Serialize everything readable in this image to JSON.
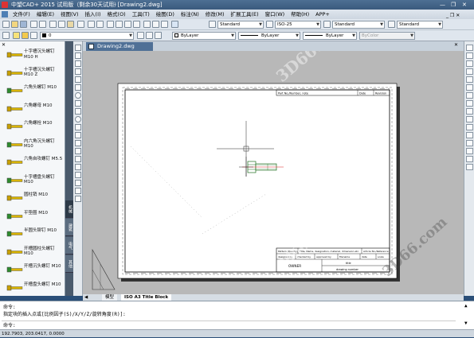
{
  "window": {
    "app_name": "中望CAD+ 2015 试用版（剩余30天试用）",
    "doc_title": "- [Drawing2.dwg]",
    "controls": [
      "—",
      "❐",
      "✕"
    ]
  },
  "menu": [
    "文件(F)",
    "编辑(E)",
    "视图(V)",
    "插入(I)",
    "格式(O)",
    "工具(T)",
    "绘图(D)",
    "标注(N)",
    "修改(M)",
    "扩展工具(E)",
    "窗口(W)",
    "帮助(H)",
    "APP+"
  ],
  "toolbar": {
    "text_style": "Standard",
    "dim_style": "ISO-25",
    "table_style": "Standard",
    "multileader_style": "Standard",
    "layer": "0",
    "color": "ByLayer",
    "linetype": "ByLayer",
    "lineweight": "ByLayer",
    "plotstyle": "ByColor"
  },
  "palette": {
    "items": [
      {
        "label": "十字槽沉头螺钉 M10 H",
        "icon": "countersunk-cross-screw-icon"
      },
      {
        "label": "十字槽沉头螺钉 M10 Z",
        "icon": "countersunk-cross-screw-icon"
      },
      {
        "label": "六角头螺钉 M10",
        "icon": "hex-bolt-icon"
      },
      {
        "label": "六角螺母 M10",
        "icon": "hex-nut-icon"
      },
      {
        "label": "六角螺栓 M10",
        "icon": "hex-bolt-icon"
      },
      {
        "label": "内六角沉头螺钉 M10",
        "icon": "socket-countersunk-screw-icon"
      },
      {
        "label": "六角自攻螺钉 M5.5",
        "icon": "tapping-screw-icon"
      },
      {
        "label": "十字槽盘头螺钉 M10",
        "icon": "pan-head-screw-icon"
      },
      {
        "label": "圆柱销 M10",
        "icon": "cylinder-pin-icon"
      },
      {
        "label": "平垫圈 M10",
        "icon": "washer-icon"
      },
      {
        "label": "半圆头铆钉 M10",
        "icon": "rivet-icon"
      },
      {
        "label": "开槽圆柱头螺钉 M10",
        "icon": "slotted-cheese-screw-icon"
      },
      {
        "label": "开槽沉头螺钉 M10",
        "icon": "slotted-countersunk-screw-icon"
      },
      {
        "label": "开槽盘头螺钉 M10",
        "icon": "slotted-pan-screw-icon"
      }
    ],
    "vertical_tabs": [
      "机械",
      "建筑",
      "电气",
      "其他"
    ]
  },
  "document_tab": "Drawing2.dwg",
  "title_block": {
    "header_cells": [
      "Part No./Number, note",
      "Date",
      "Revision"
    ],
    "mid_row": [
      "Pattern (Quality)",
      "Title, Name, designation, material, dimension etc.",
      "Article No./Reference"
    ],
    "sign_row": [
      "designed by",
      "checked by",
      "approved by",
      "filename",
      "date",
      "scale"
    ],
    "owner": "OWNER",
    "title": "title",
    "drawing_number": "drawing number"
  },
  "layout_tabs": [
    "模型",
    "ISO A3 Title Block"
  ],
  "command": {
    "line1": "命令:",
    "line2": "指定块的插入点或[比例因子(S)/X/Y/Z/旋转角度(R)]:",
    "prompt": "命令:"
  },
  "status": {
    "coordinates": "192.7903, 203.0417, 0.0000"
  },
  "watermarks": [
    "3d66.com",
    "3D66.com",
    "3d66.com",
    "3D66.com"
  ],
  "colors": {
    "titlebar": "#3a5a7d",
    "canvas_bg": "#b8b8b8",
    "paper": "#ffffff",
    "bolt_green": "#2e8b2e",
    "palette_accent": "#c8a000"
  }
}
